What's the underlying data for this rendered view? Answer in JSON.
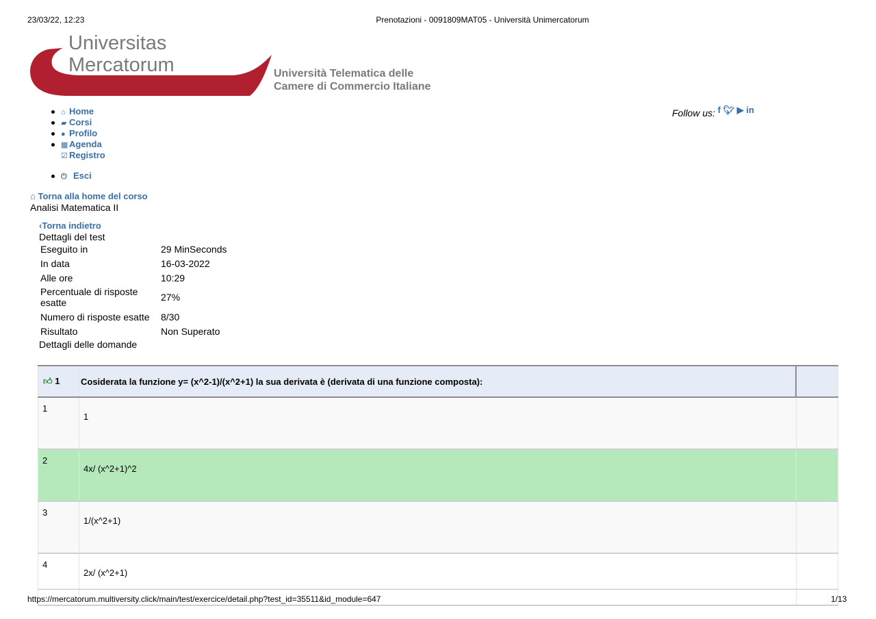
{
  "print_header": {
    "datetime": "23/03/22, 12:23",
    "title": "Prenotazioni - 0091809MAT05 - Università Unimercatorum"
  },
  "logo": {
    "line1": "Universitas",
    "line2": "Mercatorum",
    "tagline1": "Università Telematica delle",
    "tagline2": "Camere di Commercio Italiane",
    "color_red": "#b0202f",
    "color_gray": "#7a7a7a"
  },
  "nav": {
    "items": [
      {
        "label": "Home",
        "icon": "home-icon"
      },
      {
        "label": "Corsi",
        "icon": "book-icon"
      },
      {
        "label": "Profilo",
        "icon": "user-icon"
      },
      {
        "label": "Agenda",
        "icon": "calendar-icon"
      }
    ],
    "registro": "Registro",
    "esci": "Esci"
  },
  "follow": {
    "label": "Follow us:",
    "icons": [
      "facebook-icon",
      "twitter-icon",
      "youtube-icon",
      "linkedin-icon"
    ]
  },
  "course": {
    "back_home": "Torna alla home del corso",
    "name": "Analisi Matematica II"
  },
  "test": {
    "back": "Torna indietro",
    "details_title": "Dettagli del test",
    "rows": [
      {
        "label": "Eseguito in",
        "value": "29 MinSeconds"
      },
      {
        "label": "In data",
        "value": "16-03-2022"
      },
      {
        "label": "Alle ore",
        "value": "10:29"
      },
      {
        "label": "Percentuale di risposte esatte",
        "value": "27%"
      },
      {
        "label": "Numero di risposte esatte",
        "value": "8/30"
      },
      {
        "label": "Risultato",
        "value": "Non Superato"
      }
    ],
    "questions_title": "Dettagli delle domande"
  },
  "question": {
    "number": "1",
    "text": "Cosiderata la funzione y= (x^2-1)/(x^2+1) la sua derivata è (derivata di una funzione composta):",
    "status_icon": "thumbs-up-icon",
    "answers": [
      {
        "num": "1",
        "text": "1"
      },
      {
        "num": "2",
        "text": "4x/ (x^2+1)^2"
      },
      {
        "num": "3",
        "text": "1/(x^2+1)"
      },
      {
        "num": "4",
        "text": "2x/ (x^2+1)"
      }
    ]
  },
  "print_footer": {
    "url": "https://mercatorum.multiversity.click/main/test/exercice/detail.php?test_id=35511&id_module=647",
    "page": "1/13"
  }
}
